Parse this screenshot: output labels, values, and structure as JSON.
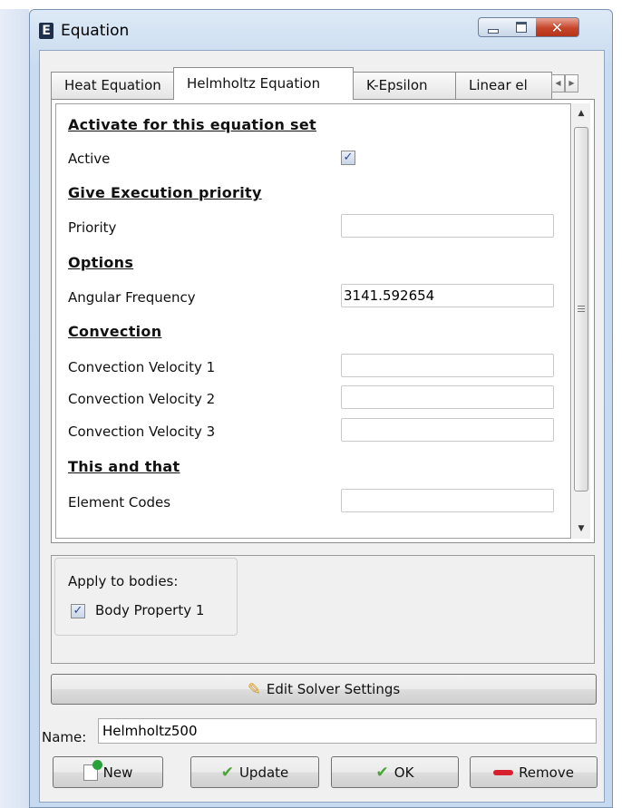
{
  "window": {
    "title": "Equation",
    "icon_letter": "E"
  },
  "tabs": [
    {
      "label": "Heat Equation"
    },
    {
      "label": "Helmholtz Equation"
    },
    {
      "label": "K-Epsilon"
    },
    {
      "label": "Linear el"
    }
  ],
  "active_tab": "Helmholtz Equation",
  "form": {
    "section_activate": "Activate for this equation set",
    "active_label": "Active",
    "active_checked": true,
    "section_priority": "Give Execution priority",
    "priority_label": "Priority",
    "priority_value": "",
    "section_options": "Options",
    "angular_frequency_label": "Angular Frequency",
    "angular_frequency_value": "3141.592654",
    "section_convection": "Convection",
    "conv1_label": "Convection Velocity 1",
    "conv1_value": "",
    "conv2_label": "Convection Velocity 2",
    "conv2_value": "",
    "conv3_label": "Convection Velocity 3",
    "conv3_value": "",
    "section_this_and_that": "This and that",
    "element_codes_label": "Element Codes",
    "element_codes_value": ""
  },
  "bodies": {
    "heading": "Apply to bodies:",
    "items": [
      {
        "label": "Body Property 1",
        "checked": true
      }
    ]
  },
  "buttons": {
    "edit_solver": "Edit Solver Settings",
    "new": "New",
    "update": "Update",
    "ok": "OK",
    "remove": "Remove"
  },
  "name": {
    "label": "Name:",
    "value": "Helmholtz500"
  },
  "colors": {
    "window_frame": "#c9dcef",
    "close_button": "#c7452a",
    "check_green": "#4aa53a",
    "remove_red": "#d8202c"
  }
}
